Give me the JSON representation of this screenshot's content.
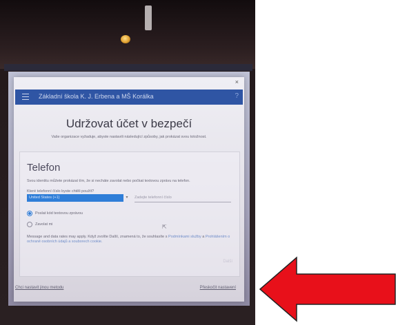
{
  "browser": {
    "url": ""
  },
  "header": {
    "org_name": "Základní škola K. J. Erbena a MŠ Korálka",
    "help_label": "?"
  },
  "dialog": {
    "close_label": "×",
    "title": "Udržovat účet v bezpečí",
    "subtitle": "Vaše organizace vyžaduje, abyste nastavili následující způsoby, jak prokázat svou totožnost."
  },
  "phone_section": {
    "title": "Telefon",
    "description": "Svou identitu můžete prokázat tím, že si necháte zavolat nebo počkat textovou zprávu na telefon.",
    "phone_label": "Které telefonní číslo byste chtěli použít?",
    "country_value": "United States (+1)",
    "phone_placeholder": "Zadejte telefonní číslo",
    "option_text": "Poslat kód textovou zprávou",
    "option_call": "Zavolat mi",
    "legal_text": "Message and data rates may apply. Když zvolíte Další, znamená to, že souhlasíte s",
    "legal_link1": "Podmínkami služby",
    "legal_and": "a",
    "legal_link2": "Prohlášením o ochraně osobních údajů a souborech cookie.",
    "next_label": "Další"
  },
  "links": {
    "alternate_method": "Chci nastavit jinou metodu",
    "skip": "Přeskočit nastavení"
  },
  "colors": {
    "header": "#2f55a4",
    "accent": "#2f7ed8",
    "arrow": "#e8101a"
  }
}
